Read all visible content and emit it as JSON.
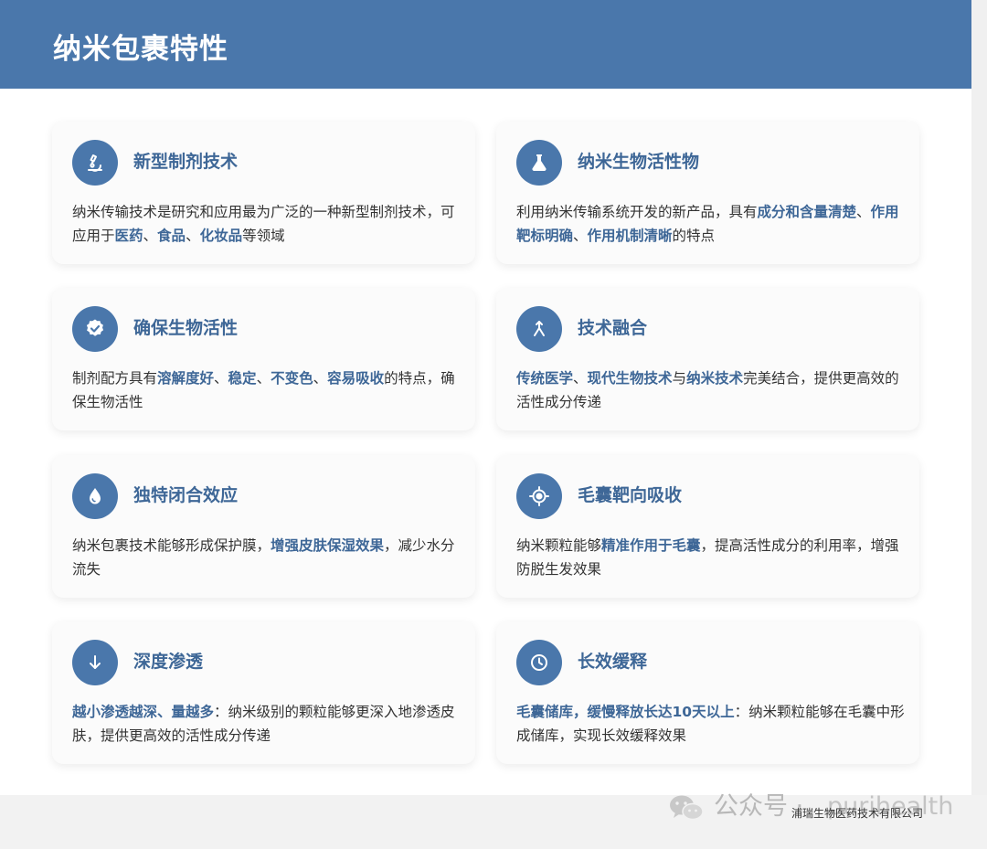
{
  "header": {
    "title": "纳米包裹特性"
  },
  "cards": [
    {
      "icon": "microscope-icon",
      "title": "新型制剂技术",
      "body": [
        {
          "t": "纳米传输技术是研究和应用最为广泛的一种新型制剂技术，可应用于"
        },
        {
          "t": "医药",
          "hl": true
        },
        {
          "t": "、"
        },
        {
          "t": "食品",
          "hl": true
        },
        {
          "t": "、"
        },
        {
          "t": "化妆品",
          "hl": true
        },
        {
          "t": "等领域"
        }
      ]
    },
    {
      "icon": "flask-icon",
      "title": "纳米生物活性物",
      "body": [
        {
          "t": "利用纳米传输系统开发的新产品，具有"
        },
        {
          "t": "成分和含量清楚",
          "hl": true
        },
        {
          "t": "、"
        },
        {
          "t": "作用靶标明确",
          "hl": true
        },
        {
          "t": "、"
        },
        {
          "t": "作用机制清晰",
          "hl": true
        },
        {
          "t": "的特点"
        }
      ]
    },
    {
      "icon": "verified-badge-icon",
      "title": "确保生物活性",
      "body": [
        {
          "t": "制剂配方具有"
        },
        {
          "t": "溶解度好",
          "hl": true
        },
        {
          "t": "、"
        },
        {
          "t": "稳定",
          "hl": true
        },
        {
          "t": "、"
        },
        {
          "t": "不变色",
          "hl": true
        },
        {
          "t": "、"
        },
        {
          "t": "容易吸收",
          "hl": true
        },
        {
          "t": "的特点，确保生物活性"
        }
      ]
    },
    {
      "icon": "merge-icon",
      "title": "技术融合",
      "body": [
        {
          "t": "传统医学",
          "hl": true
        },
        {
          "t": "、"
        },
        {
          "t": "现代生物技术",
          "hl": true
        },
        {
          "t": "与"
        },
        {
          "t": "纳米技术",
          "hl": true
        },
        {
          "t": "完美结合，提供更高效的活性成分传递"
        }
      ]
    },
    {
      "icon": "water-drop-icon",
      "title": "独特闭合效应",
      "body": [
        {
          "t": "纳米包裹技术能够形成保护膜，"
        },
        {
          "t": "增强皮肤保湿效果",
          "hl": true
        },
        {
          "t": "，减少水分流失"
        }
      ]
    },
    {
      "icon": "target-icon",
      "title": "毛囊靶向吸收",
      "body": [
        {
          "t": "纳米颗粒能够"
        },
        {
          "t": "精准作用于毛囊",
          "hl": true
        },
        {
          "t": "，提高活性成分的利用率，增强防脱生发效果"
        }
      ]
    },
    {
      "icon": "arrow-down-icon",
      "title": "深度渗透",
      "body": [
        {
          "t": "越小渗透越深、量越多",
          "hl": true
        },
        {
          "t": "：纳米级别的颗粒能够更深入地渗透皮肤，提供更高效的活性成分传递"
        }
      ]
    },
    {
      "icon": "clock-icon",
      "title": "长效缓释",
      "body": [
        {
          "t": "毛囊储库，缓慢释放长达10天以上",
          "hl": true
        },
        {
          "t": "：纳米颗粒能够在毛囊中形成储库，实现长效缓释效果"
        }
      ]
    }
  ],
  "footer": {
    "watermark_text": "公众号 ·",
    "watermark_handle": "purihealth",
    "company": "浦瑞生物医药技术有限公司"
  },
  "colors": {
    "header_bg": "#4a77ab",
    "accent_text": "#3e6797",
    "body_text": "#333333",
    "card_bg": "#fbfbfb"
  }
}
